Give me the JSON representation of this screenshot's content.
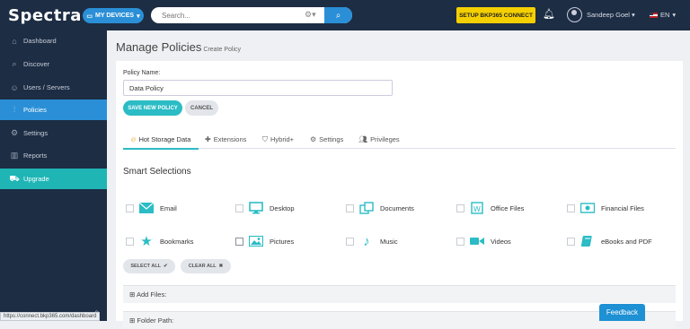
{
  "topbar": {
    "logo": "Spectra",
    "devices_label": "MY DEVICES",
    "search_placeholder": "Search...",
    "setup_label": "SETUP BKP365 CONNECT",
    "user_name": "Sandeep Goel",
    "language": "EN"
  },
  "sidebar": {
    "items": [
      {
        "label": "Dashboard",
        "icon": "dashboard-icon"
      },
      {
        "label": "Discover",
        "icon": "search-icon"
      },
      {
        "label": "Users / Servers",
        "icon": "users-icon"
      },
      {
        "label": "Policies",
        "icon": "sliders-icon",
        "active": true
      },
      {
        "label": "Settings",
        "icon": "gear-icon"
      },
      {
        "label": "Reports",
        "icon": "chart-icon"
      },
      {
        "label": "Upgrade",
        "icon": "cart-icon",
        "highlight": true
      }
    ]
  },
  "status_url": "https://connect.bkp365.com/dashboard",
  "page": {
    "title": "Manage Policies",
    "subtitle": "Create Policy",
    "policy_name_label": "Policy Name:",
    "policy_name_value": "Data Policy",
    "save_label": "SAVE NEW POLICY",
    "cancel_label": "CANCEL"
  },
  "tabs": [
    {
      "label": "Hot Storage Data",
      "active": true
    },
    {
      "label": "Extensions"
    },
    {
      "label": "Hybrid+"
    },
    {
      "label": "Settings"
    },
    {
      "label": "Privileges"
    }
  ],
  "smart_selections": {
    "title": "Smart Selections",
    "items": [
      {
        "label": "Email",
        "icon": "email-icon",
        "checked": false
      },
      {
        "label": "Desktop",
        "icon": "desktop-icon",
        "checked": false
      },
      {
        "label": "Documents",
        "icon": "documents-icon",
        "checked": false
      },
      {
        "label": "Office Files",
        "icon": "office-files-icon",
        "checked": false
      },
      {
        "label": "Financial Files",
        "icon": "money-icon",
        "checked": false
      },
      {
        "label": "Bookmarks",
        "icon": "star-icon",
        "checked": false
      },
      {
        "label": "Pictures",
        "icon": "image-icon",
        "checked": false
      },
      {
        "label": "Music",
        "icon": "music-icon",
        "checked": false
      },
      {
        "label": "Videos",
        "icon": "video-icon",
        "checked": false
      },
      {
        "label": "eBooks and PDF",
        "icon": "book-icon",
        "checked": false
      }
    ],
    "select_all_label": "SELECT ALL",
    "clear_all_label": "CLEAR ALL"
  },
  "panels": {
    "add_files": "Add Files:",
    "folder_path": "Folder Path:"
  },
  "feedback_label": "Feedback",
  "colors": {
    "nav_bg": "#1d2d44",
    "accent_blue": "#2a8fd6",
    "accent_teal": "#2bbcc5",
    "setup_yellow": "#f5d000"
  }
}
